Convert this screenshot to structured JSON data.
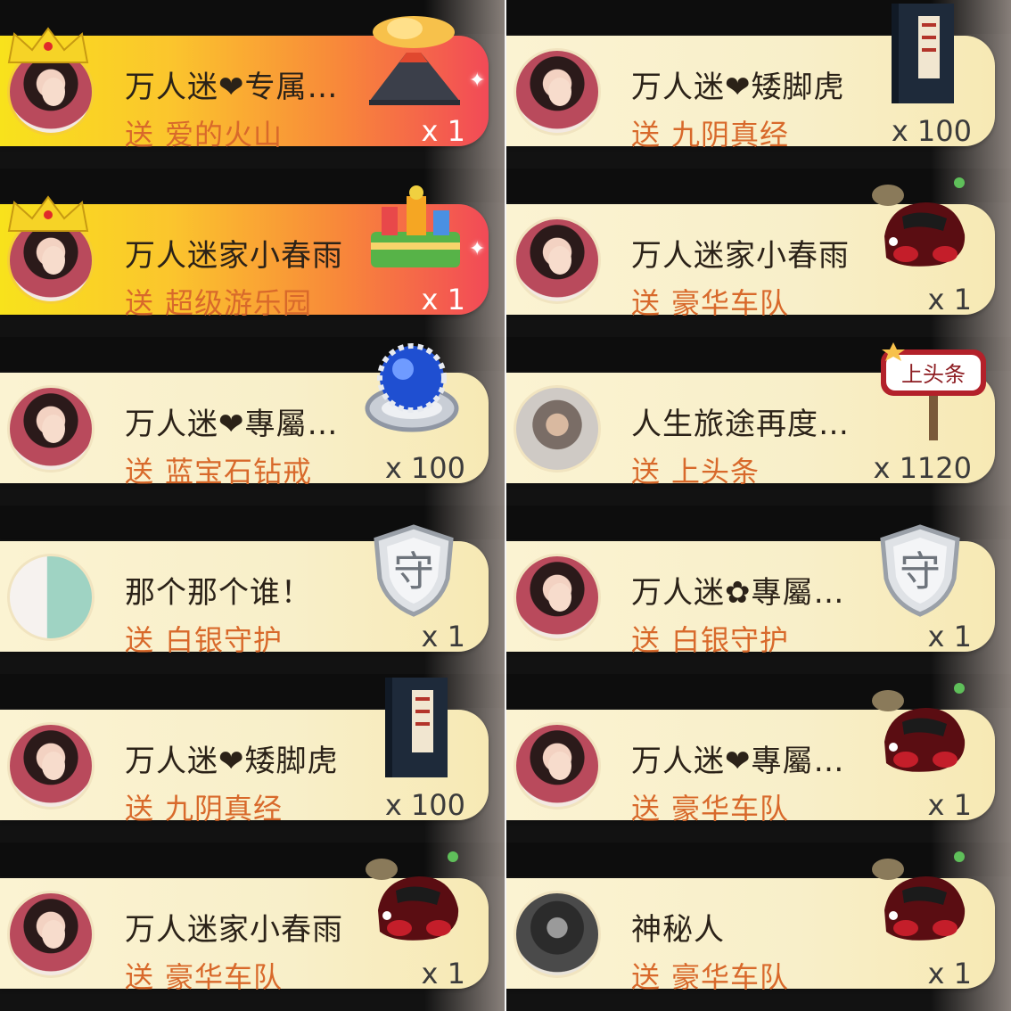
{
  "left_column": [
    {
      "name": "万人迷❤专属…",
      "send_label": "送",
      "gift": "爱的火山",
      "qty": "x 1",
      "style": "gold",
      "avatar": "avatar-woman",
      "icon": "volcano-icon"
    },
    {
      "name": "万人迷家小春雨",
      "send_label": "送",
      "gift": "超级游乐园",
      "qty": "x 1",
      "style": "gold",
      "avatar": "avatar-woman",
      "icon": "amusement-park-icon"
    },
    {
      "name": "万人迷❤專屬…",
      "send_label": "送",
      "gift": "蓝宝石钻戒",
      "qty": "x 100",
      "style": "plain",
      "avatar": "avatar-woman",
      "icon": "sapphire-ring-icon"
    },
    {
      "name": "那个那个谁！",
      "send_label": "送",
      "gift": "白银守护",
      "qty": "x 1",
      "style": "plain",
      "avatar": "avatar-couple",
      "icon": "silver-guard-shield-icon"
    },
    {
      "name": "万人迷❤矮脚虎",
      "send_label": "送",
      "gift": "九阴真经",
      "qty": "x 100",
      "style": "plain",
      "avatar": "avatar-woman",
      "icon": "book-icon"
    },
    {
      "name": "万人迷家小春雨",
      "send_label": "送",
      "gift": "豪华车队",
      "qty": "x 1",
      "style": "plain",
      "avatar": "avatar-woman",
      "icon": "sports-car-icon"
    }
  ],
  "right_column": [
    {
      "name": "万人迷❤矮脚虎",
      "send_label": "送",
      "gift": "九阴真经",
      "qty": "x 100",
      "style": "plain",
      "avatar": "avatar-woman",
      "icon": "book-icon"
    },
    {
      "name": "万人迷家小春雨",
      "send_label": "送",
      "gift": "豪华车队",
      "qty": "x 1",
      "style": "plain",
      "avatar": "avatar-woman",
      "icon": "sports-car-icon"
    },
    {
      "name": "人生旅途再度…",
      "send_label": "送",
      "gift": "上头条",
      "qty": "x 1120",
      "style": "plain",
      "avatar": "avatar-man",
      "icon": "headline-sign-icon"
    },
    {
      "name": "万人迷✿專屬…",
      "send_label": "送",
      "gift": "白银守护",
      "qty": "x 1",
      "style": "plain",
      "avatar": "avatar-woman",
      "icon": "silver-guard-shield-icon"
    },
    {
      "name": "万人迷❤專屬…",
      "send_label": "送",
      "gift": "豪华车队",
      "qty": "x 1",
      "style": "plain",
      "avatar": "avatar-woman",
      "icon": "sports-car-icon"
    },
    {
      "name": "神秘人",
      "send_label": "送",
      "gift": "豪华车队",
      "qty": "x 1",
      "style": "plain",
      "avatar": "avatar-mystery",
      "icon": "sports-car-icon"
    }
  ],
  "icon_text": {
    "guard": "守",
    "headline": "上头条"
  },
  "colors": {
    "gold_start": "#f8e21c",
    "gold_end": "#f24a57",
    "plain_bg": "#fbf3d2",
    "gift_text": "#d8692b",
    "name_text": "#2b2218"
  }
}
